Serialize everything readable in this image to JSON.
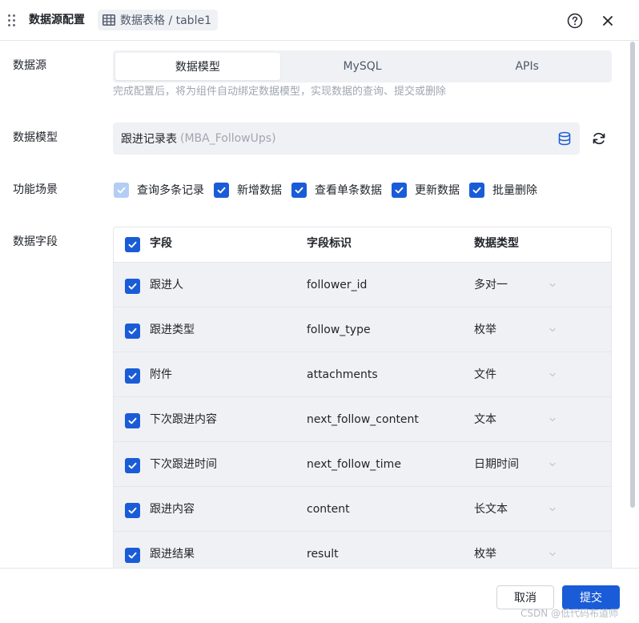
{
  "header": {
    "title": "数据源配置",
    "source_label": "数据表格 / table1"
  },
  "datasource": {
    "label": "数据源",
    "tabs": [
      "数据模型",
      "MySQL",
      "APIs"
    ],
    "active_tab": "数据模型",
    "hint": "完成配置后，将为组件自动绑定数据模型，实现数据的查询、提交或删除"
  },
  "model": {
    "label": "数据模型",
    "name": "跟进记录表",
    "code": "(MBA_FollowUps)"
  },
  "scenarios": {
    "label": "功能场景",
    "items": [
      {
        "label": "查询多条记录",
        "checked": true,
        "disabled": true
      },
      {
        "label": "新增数据",
        "checked": true,
        "disabled": false
      },
      {
        "label": "查看单条数据",
        "checked": true,
        "disabled": false
      },
      {
        "label": "更新数据",
        "checked": true,
        "disabled": false
      },
      {
        "label": "批量删除",
        "checked": true,
        "disabled": false
      }
    ]
  },
  "fields": {
    "label": "数据字段",
    "headers": {
      "name": "字段",
      "key": "字段标识",
      "type": "数据类型"
    },
    "rows": [
      {
        "name": "跟进人",
        "key": "follower_id",
        "type": "多对一"
      },
      {
        "name": "跟进类型",
        "key": "follow_type",
        "type": "枚举"
      },
      {
        "name": "附件",
        "key": "attachments",
        "type": "文件"
      },
      {
        "name": "下次跟进内容",
        "key": "next_follow_content",
        "type": "文本"
      },
      {
        "name": "下次跟进时间",
        "key": "next_follow_time",
        "type": "日期时间"
      },
      {
        "name": "跟进内容",
        "key": "content",
        "type": "长文本"
      },
      {
        "name": "跟进结果",
        "key": "result",
        "type": "枚举"
      }
    ]
  },
  "footer": {
    "cancel": "取消",
    "submit": "提交",
    "watermark": "CSDN @低代码布道师"
  },
  "colors": {
    "primary": "#1a5cd7",
    "field_bg": "#f0f1f5"
  }
}
